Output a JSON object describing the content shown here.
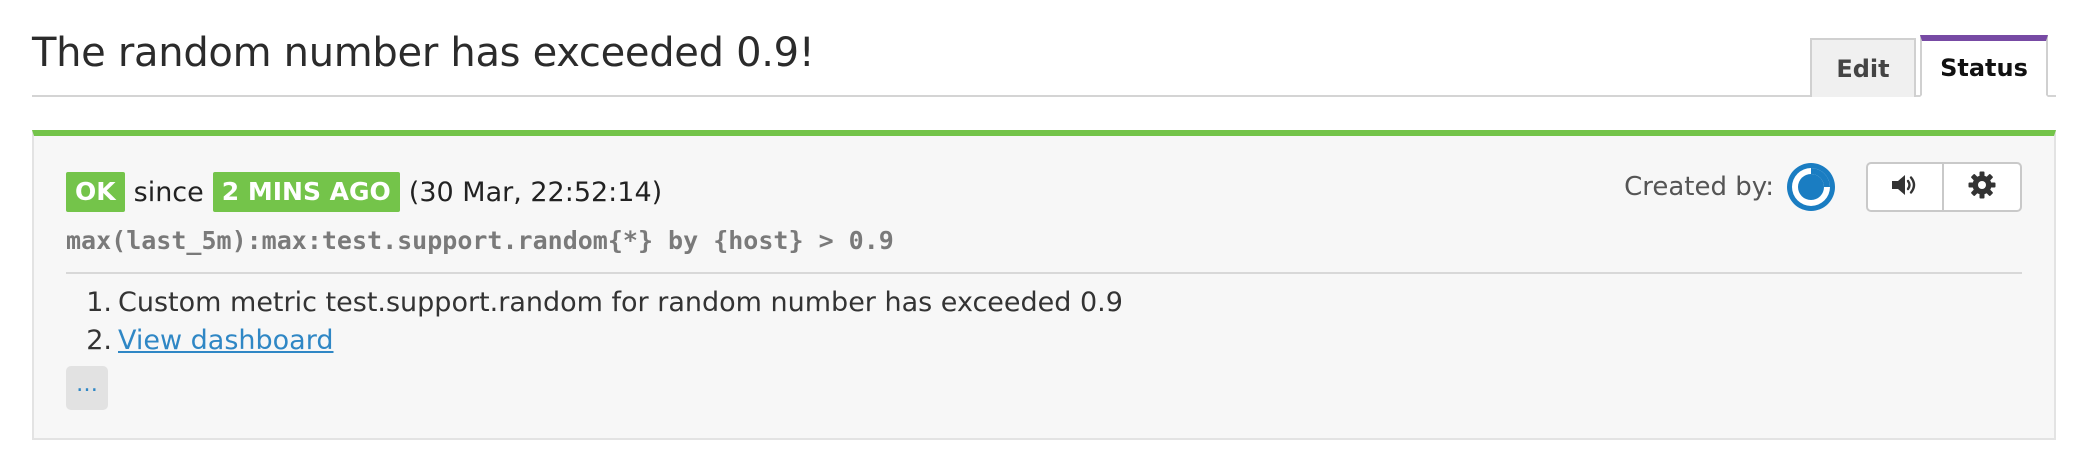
{
  "header": {
    "title": "The random number has exceeded 0.9!",
    "tabs": {
      "edit": "Edit",
      "status": "Status",
      "active": "Status"
    }
  },
  "monitor": {
    "status_badge": "OK",
    "since_text": "since",
    "time_badge": "2 MINS AGO",
    "timestamp": "(30 Mar, 22:52:14)",
    "query": "max(last_5m):max:test.support.random{*} by {host} > 0.9",
    "messages": [
      {
        "number": "1.",
        "text": "Custom metric test.support.random for random number has exceeded 0.9"
      },
      {
        "number": "2.",
        "link_text": "View dashboard"
      }
    ],
    "more_label": "…",
    "created_by_label": "Created by:",
    "avatar_icon": "user-avatar-icon",
    "buttons": {
      "mute_icon": "speaker-volume-icon",
      "settings_icon": "gear-icon"
    }
  },
  "colors": {
    "ok_green": "#74c44a",
    "active_tab_accent": "#774aa4",
    "link_blue": "#2f87c5",
    "avatar_blue": "#1a7dc2"
  }
}
